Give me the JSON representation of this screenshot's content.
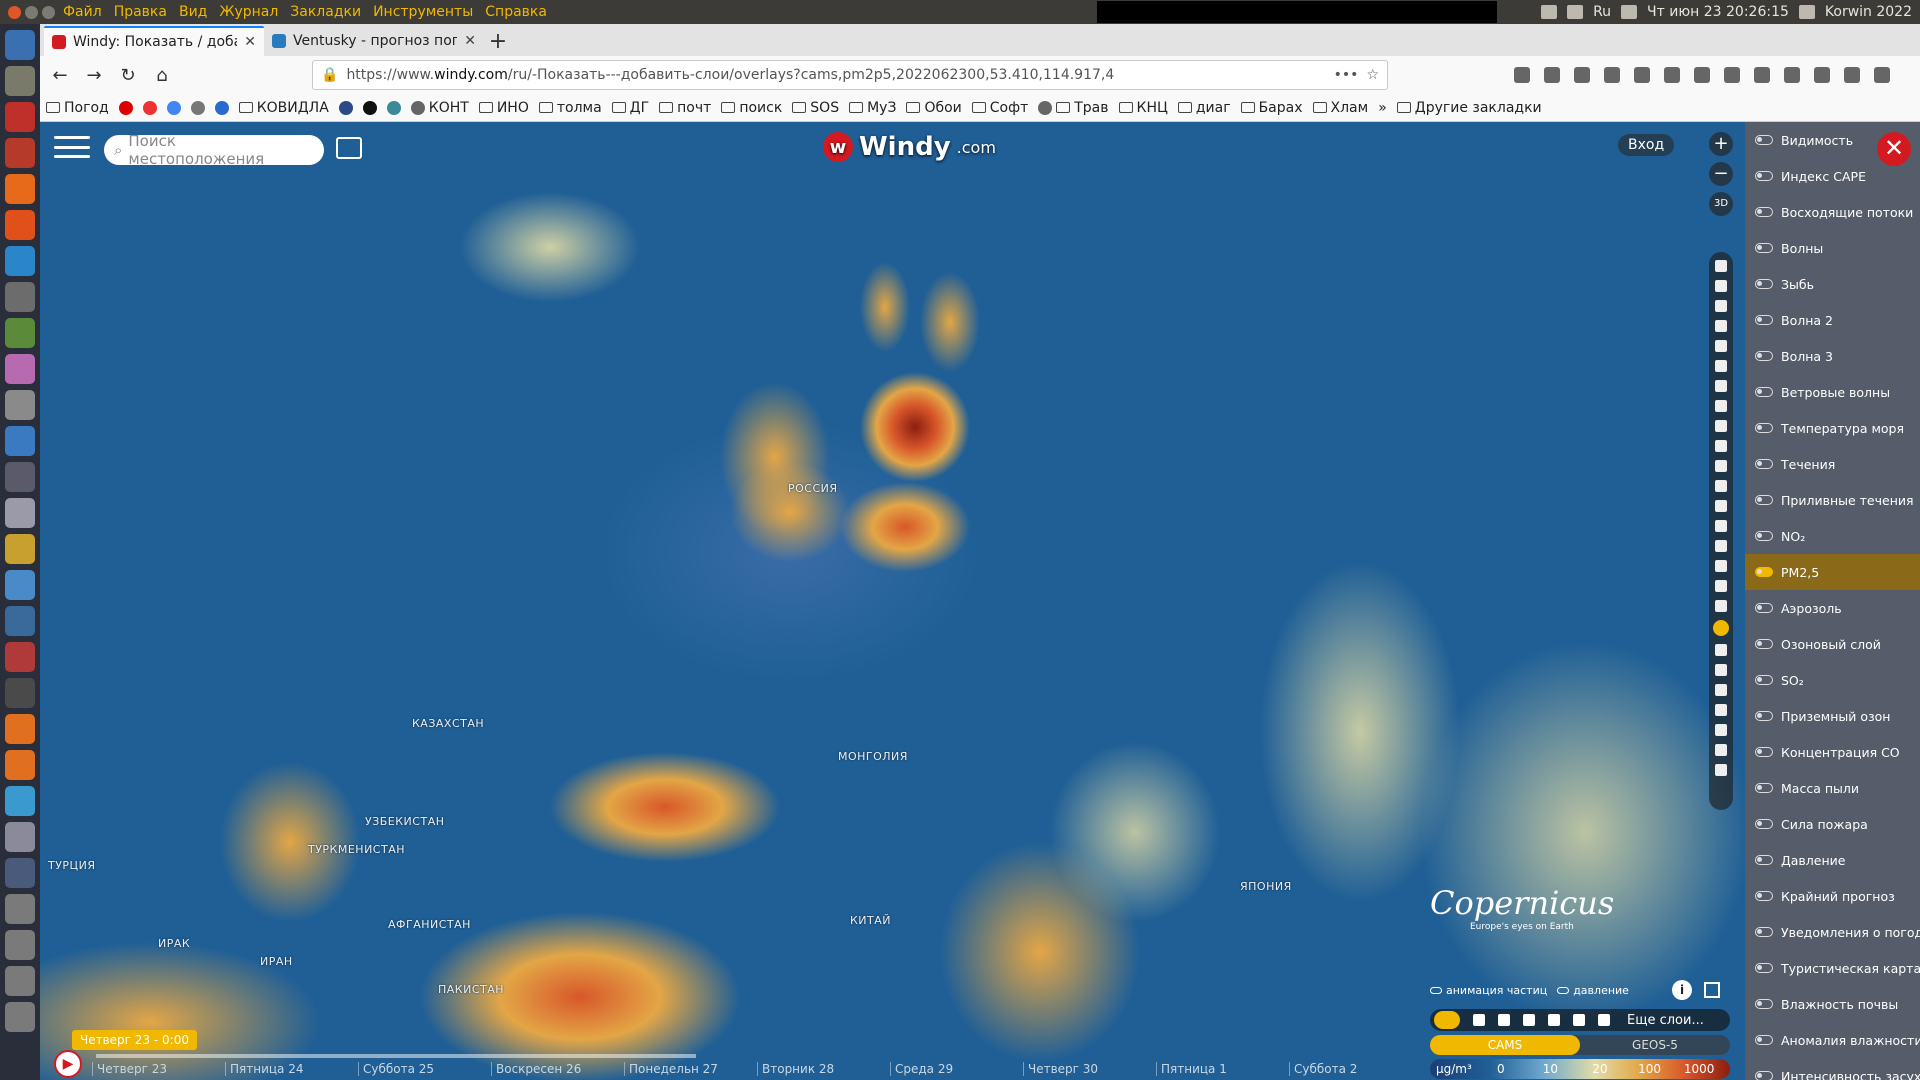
{
  "system": {
    "menu": [
      "Файл",
      "Правка",
      "Вид",
      "Журнал",
      "Закладки",
      "Инструменты",
      "Справка"
    ],
    "clock": "Чт июн 23 20:26:15",
    "user": "Korwin 2022",
    "keyboard": "Ru"
  },
  "tabs": [
    {
      "title": "Windy: Показать / доба",
      "active": true
    },
    {
      "title": "Ventusky - прогноз пог",
      "active": false
    }
  ],
  "url": {
    "prefix": "https://www.",
    "domain": "windy.com",
    "path": "/ru/-Показать---добавить-слои/overlays?cams,pm2p5,2022062300,53.410,114.917,4"
  },
  "bookmarks": [
    "Погод",
    "КОВИДЛА",
    "КОНТ",
    "ИНО",
    "толма",
    "ДГ",
    "почт",
    "поиск",
    "SOS",
    "МуЗ",
    "Обои",
    "Софт",
    "Трав",
    "КНЦ",
    "диаг",
    "Барах",
    "Хлам"
  ],
  "bookmarks_more": "Другие закладки",
  "map": {
    "logo": "Windy",
    "logo_suffix": ".com",
    "search_placeholder": "Поиск местоположения",
    "login": "Вход",
    "labels": [
      "РОССИЯ",
      "КАЗАХСТАН",
      "МОНГОЛИЯ",
      "УЗБЕКИСТАН",
      "ТУРКМЕНИСТАН",
      "ТУРЦИЯ",
      "ИРАН",
      "АФГАНИСТАН",
      "ПАКИСТАН",
      "КИТАЙ",
      "ЯПОНИЯ",
      "ИРАК"
    ],
    "brand": "Copernicus",
    "brand_sub": "Europe's eyes on Earth",
    "option1": "анимация частиц",
    "option2": "давление",
    "more_layers": "Еще слои...",
    "models": [
      "CAMS",
      "GEOS-5"
    ],
    "legend_unit": "µg/m³",
    "legend_values": [
      "0",
      "10",
      "20",
      "100",
      "1000"
    ],
    "time_label": "Четверг 23 - 0:00",
    "days": [
      "Четверг 23",
      "Пятница 24",
      "Суббота 25",
      "Воскресен 26",
      "Понедельн 27",
      "Вторник 28",
      "Среда 29",
      "Четверг 30",
      "Пятница 1",
      "Суббота 2"
    ]
  },
  "layers": [
    {
      "label": "Видимость",
      "active": false
    },
    {
      "label": "Индекс CAPE",
      "active": false
    },
    {
      "label": "Восходящие потоки",
      "active": false
    },
    {
      "label": "Волны",
      "active": false
    },
    {
      "label": "Зыбь",
      "active": false
    },
    {
      "label": "Волна 2",
      "active": false
    },
    {
      "label": "Волна 3",
      "active": false
    },
    {
      "label": "Ветровые волны",
      "active": false
    },
    {
      "label": "Температура моря",
      "active": false
    },
    {
      "label": "Течения",
      "active": false
    },
    {
      "label": "Приливные течения",
      "active": false
    },
    {
      "label": "NO₂",
      "active": false
    },
    {
      "label": "PM2,5",
      "active": true
    },
    {
      "label": "Аэрозоль",
      "active": false
    },
    {
      "label": "Озоновый слой",
      "active": false
    },
    {
      "label": "SO₂",
      "active": false
    },
    {
      "label": "Приземный озон",
      "active": false
    },
    {
      "label": "Концентрация CO",
      "active": false
    },
    {
      "label": "Масса пыли",
      "active": false
    },
    {
      "label": "Сила пожара",
      "active": false
    },
    {
      "label": "Давление",
      "active": false
    },
    {
      "label": "Крайний прогноз",
      "active": false
    },
    {
      "label": "Уведомления о погоде",
      "active": false
    },
    {
      "label": "Туристическая карта",
      "active": false
    },
    {
      "label": "Влажность почвы",
      "active": false
    },
    {
      "label": "Аномалия влажности",
      "active": false
    },
    {
      "label": "Интенсивность засух",
      "active": false
    }
  ]
}
